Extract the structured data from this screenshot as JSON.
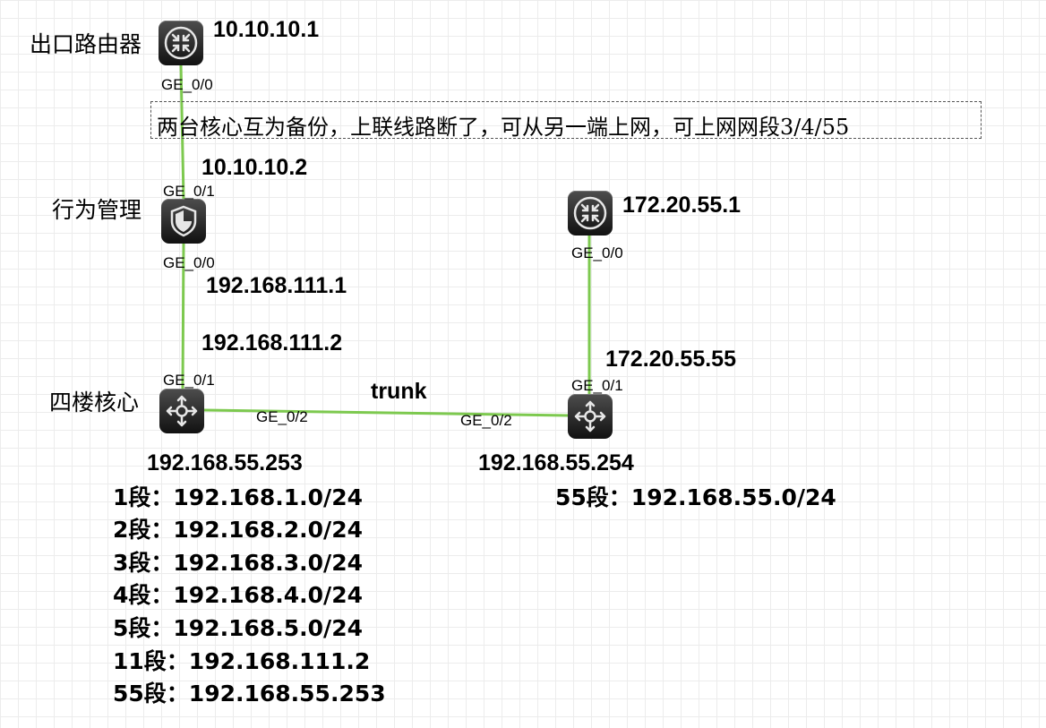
{
  "devices": {
    "exit_router": {
      "name": "出口路由器",
      "ip": "10.10.10.1",
      "port": "GE_0/0"
    },
    "behavior_mgmt": {
      "name": "行为管理",
      "ip_up": "10.10.10.2",
      "port_up": "GE_0/1",
      "port_down": "GE_0/0",
      "ip_down": "192.168.111.1"
    },
    "core4": {
      "name": "四楼核心",
      "ip_up": "192.168.111.2",
      "port_up": "GE_0/1",
      "port_trunk": "GE_0/2",
      "ip_vlan": "192.168.55.253"
    },
    "router2": {
      "ip": "172.20.55.1",
      "port": "GE_0/0"
    },
    "core2": {
      "ip_up": "172.20.55.55",
      "port_up": "GE_0/1",
      "port_trunk": "GE_0/2",
      "ip_vlan": "192.168.55.254"
    }
  },
  "link_labels": {
    "trunk": "trunk"
  },
  "note": "两台核心互为备份，上联线路断了，可从另一端上网，可上网网段3/4/55",
  "segments_core4": [
    {
      "label": "1段：",
      "value": "192.168.1.0/24"
    },
    {
      "label": "2段：",
      "value": "192.168.2.0/24"
    },
    {
      "label": "3段：",
      "value": "192.168.3.0/24"
    },
    {
      "label": "4段：",
      "value": "192.168.4.0/24"
    },
    {
      "label": "5段：",
      "value": "192.168.5.0/24"
    },
    {
      "label": "11段：",
      "value": "192.168.111.2"
    },
    {
      "label": "55段：",
      "value": "192.168.55.253"
    }
  ],
  "segment_core2": {
    "label": "55段：",
    "value": "192.168.55.0/24"
  },
  "colors": {
    "link": "#7dc94f",
    "device_dark": "#222222",
    "device_icon": "#e6e6e6"
  },
  "icons": {
    "router": "router-icon",
    "firewall": "firewall-shield-icon",
    "switch": "l3-switch-icon"
  }
}
